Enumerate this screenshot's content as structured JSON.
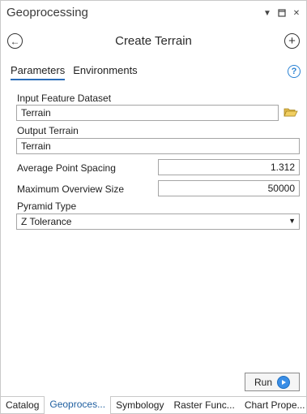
{
  "window": {
    "title": "Geoprocessing",
    "controls": [
      "chevron-down-icon",
      "pin-icon",
      "close-icon"
    ]
  },
  "header": {
    "title": "Create Terrain"
  },
  "tabs": [
    {
      "label": "Parameters",
      "active": true
    },
    {
      "label": "Environments",
      "active": false
    }
  ],
  "form": {
    "input_dataset": {
      "label": "Input Feature Dataset",
      "value": "Terrain"
    },
    "output_terrain": {
      "label": "Output Terrain",
      "value": "Terrain"
    },
    "point_spacing": {
      "label": "Average Point Spacing",
      "value": "1.312"
    },
    "overview_size": {
      "label": "Maximum Overview Size",
      "value": "50000"
    },
    "pyramid_type": {
      "label": "Pyramid Type",
      "value": "Z Tolerance"
    }
  },
  "run_label": "Run",
  "bottom_tabs": [
    {
      "label": "Catalog",
      "active": false
    },
    {
      "label": "Geoproces...",
      "active": true
    },
    {
      "label": "Symbology",
      "active": false
    },
    {
      "label": "Raster Func...",
      "active": false
    },
    {
      "label": "Chart Prope...",
      "active": false
    }
  ],
  "colors": {
    "accent": "#2a6cb8",
    "run_icon": "#3a8ee6",
    "folder": "#d9b23a"
  }
}
